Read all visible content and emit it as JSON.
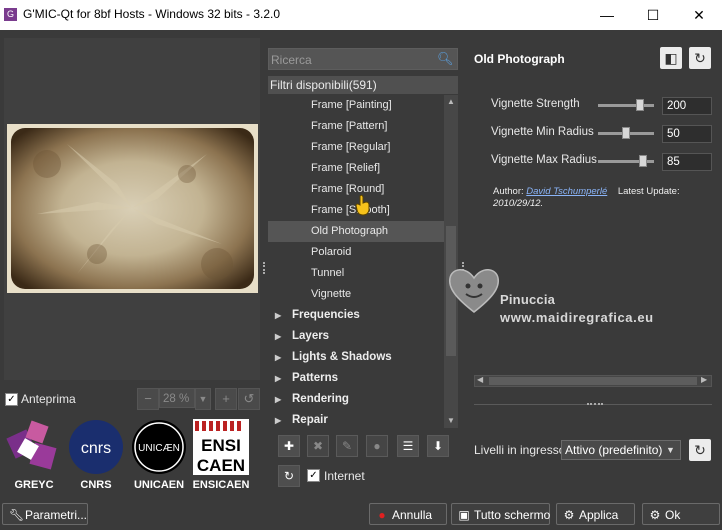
{
  "window": {
    "title": "G'MIC-Qt for 8bf Hosts - Windows 32 bits - 3.2.0",
    "controls": [
      "—",
      "☐",
      "✕"
    ]
  },
  "preview": {
    "checkbox_label": "Anteprima",
    "zoom": "28 %"
  },
  "logos": [
    "GREYC",
    "CNRS",
    "UNICAEN",
    "ENSICAEN"
  ],
  "logo_text": {
    "cnrs": "cnrs",
    "unicaen": "UNICÆN",
    "ensicaen_line1": "ENSI",
    "ensicaen_line2": "CAEN"
  },
  "search": {
    "placeholder": "Ricerca"
  },
  "filters": {
    "header": "Filtri disponibili(591)",
    "items": [
      "Frame [Painting]",
      "Frame [Pattern]",
      "Frame [Regular]",
      "Frame [Relief]",
      "Frame [Round]",
      "Frame [Smooth]",
      "Old Photograph",
      "Polaroid",
      "Tunnel",
      "Vignette"
    ],
    "selected": "Old Photograph",
    "categories": [
      "Frequencies",
      "Layers",
      "Lights & Shadows",
      "Patterns",
      "Rendering",
      "Repair"
    ]
  },
  "internet_label": "Internet",
  "filter_panel": {
    "title": "Old Photograph",
    "params": [
      {
        "label": "Vignette Strength",
        "value": "200",
        "level": 0.8
      },
      {
        "label": "Vignette Min Radius",
        "value": "50",
        "level": 0.5
      },
      {
        "label": "Vignette Max Radius",
        "value": "85",
        "level": 0.85
      }
    ],
    "author_label": "Author:",
    "author_name": "David Tschumperlé",
    "date": "2010/29/12.",
    "latest_update": "Latest Update:"
  },
  "watermark": {
    "name": "Pinuccia",
    "url": "www.maidiregrafica.eu"
  },
  "input_layers": {
    "label": "Livelli in ingresso",
    "value": "Attivo (predefinito)"
  },
  "bottom": {
    "params_button": "Parametri...",
    "cancel_button": "Annulla",
    "fullscreen_button": "Tutto schermo",
    "apply_button": "Applica",
    "ok_button": "Ok"
  },
  "colors": {
    "background": "#3a3a3a",
    "selected_item": "#555555",
    "link": "#8ab4f8",
    "cancel_icon": "#e02020"
  }
}
